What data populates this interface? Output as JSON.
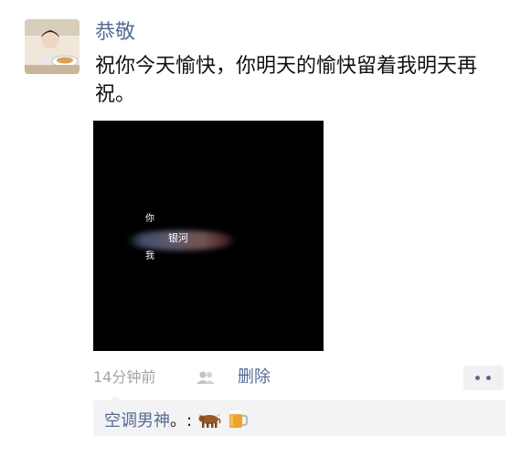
{
  "post": {
    "author_name": "恭敬",
    "text": "祝你今天愉快，你明天的愉快留着我明天再祝。",
    "image_words": {
      "you": "你",
      "galaxy": "银河",
      "me": "我"
    },
    "time": "14分钟前",
    "delete_label": "删除"
  },
  "comment": {
    "author": "空调男神",
    "separator": "。:",
    "emojis": [
      "cow-emoji",
      "beer-mug-emoji"
    ]
  },
  "colors": {
    "link_blue": "#576b95",
    "text": "#111111",
    "meta_gray": "#a3a3a3",
    "comment_bg": "#f3f3f5"
  }
}
